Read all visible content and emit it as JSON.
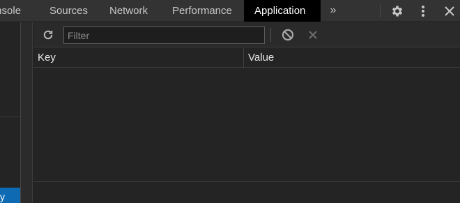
{
  "tabs": {
    "console": "Console",
    "sources": "Sources",
    "network": "Network",
    "performance": "Performance",
    "application": "Application",
    "more": "»"
  },
  "toolbar": {
    "filter_placeholder": "Filter",
    "filter_value": "",
    "refresh_icon": "refresh-icon",
    "block_icon": "block-icon",
    "clear_icon": "clear-icon"
  },
  "table": {
    "columns": [
      "Key",
      "Value"
    ],
    "rows": []
  },
  "sidebar": {
    "selected_item_partial": "y"
  },
  "icons": {
    "settings": "gear-icon",
    "more_options": "kebab-menu-icon",
    "close": "close-icon"
  },
  "colors": {
    "tabbar_bg": "#333333",
    "active_tab_bg": "#000000",
    "panel_bg": "#242424",
    "selection_blue": "#0f6ab4"
  }
}
